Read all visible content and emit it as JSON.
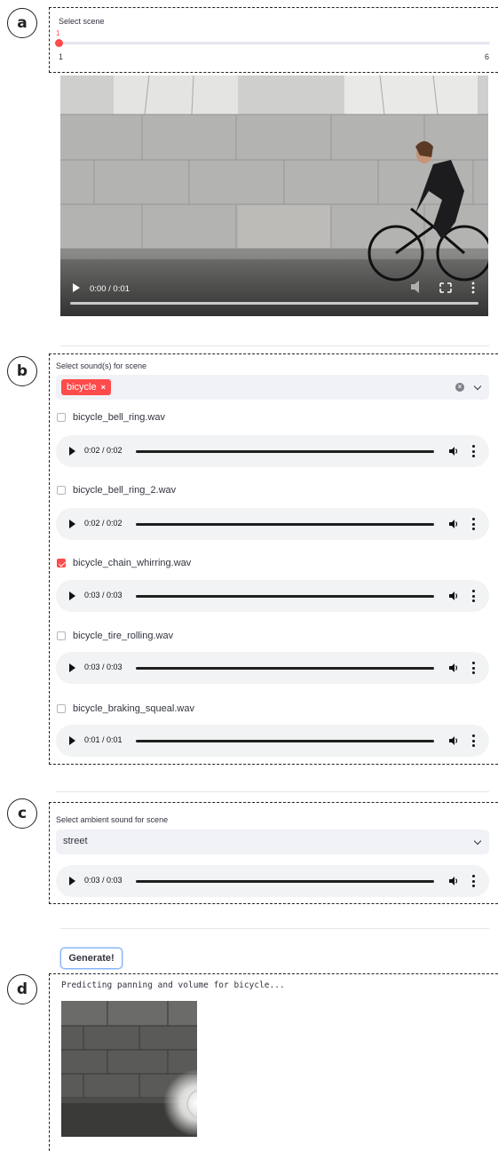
{
  "panels": [
    {
      "letter": "a"
    },
    {
      "letter": "b"
    },
    {
      "letter": "c"
    },
    {
      "letter": "d"
    }
  ],
  "scene": {
    "label": "Select scene",
    "value": "1",
    "min": "1",
    "max": "6"
  },
  "video": {
    "time": "0:00 / 0:01"
  },
  "sounds": {
    "label": "Select sound(s) for scene",
    "tag": "bicycle",
    "tag_remove": "×",
    "items": [
      {
        "name": "bicycle_bell_ring.wav",
        "checked": false,
        "time": "0:02 / 0:02"
      },
      {
        "name": "bicycle_bell_ring_2.wav",
        "checked": false,
        "time": "0:02 / 0:02"
      },
      {
        "name": "bicycle_chain_whirring.wav",
        "checked": true,
        "time": "0:03 / 0:03"
      },
      {
        "name": "bicycle_tire_rolling.wav",
        "checked": false,
        "time": "0:03 / 0:03"
      },
      {
        "name": "bicycle_braking_squeal.wav",
        "checked": false,
        "time": "0:01 / 0:01"
      }
    ]
  },
  "ambient": {
    "label": "Select ambient sound for scene",
    "value": "street",
    "time": "0:03 / 0:03"
  },
  "generate": {
    "label": "Generate!",
    "status": "Predicting panning and volume for bicycle..."
  },
  "colors": {
    "accent": "#ff4b4b",
    "select_bg": "#f0f2f6",
    "audio_bg": "#f1f3f4"
  }
}
